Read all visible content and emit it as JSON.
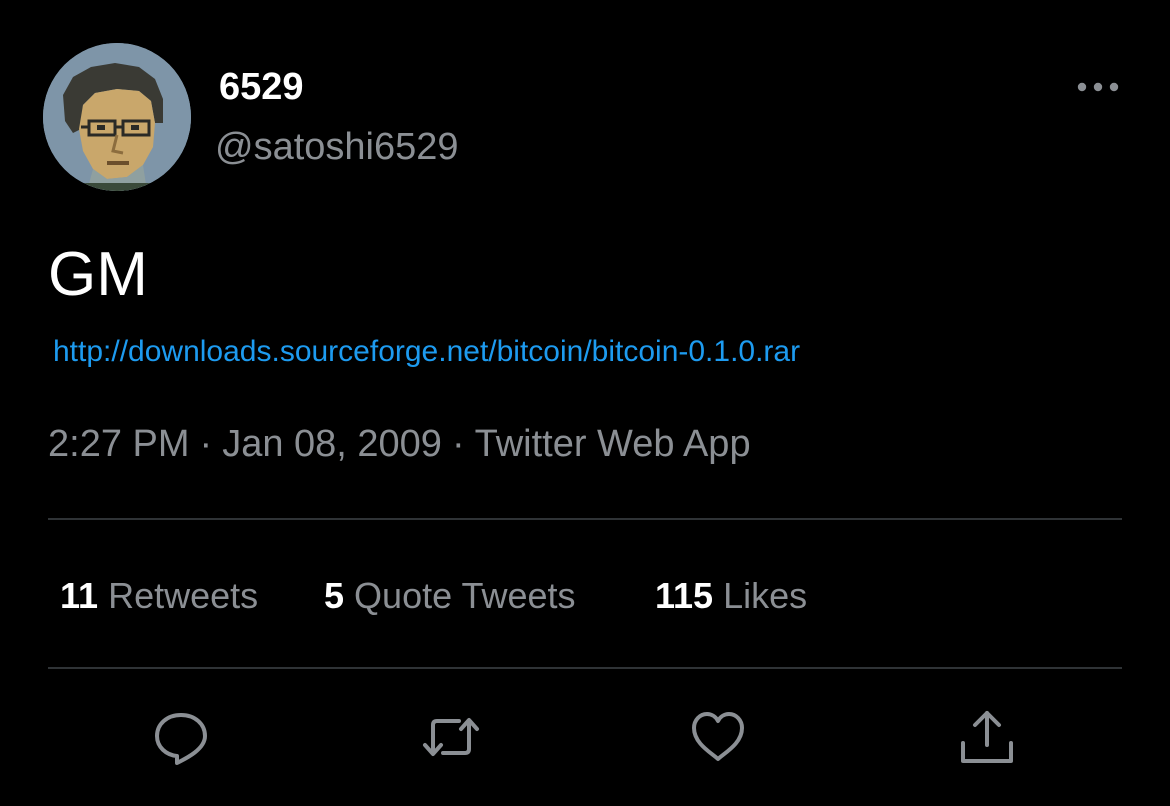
{
  "author": {
    "display_name": "6529",
    "handle": "@satoshi6529",
    "avatar": "pixel-art-portrait"
  },
  "tweet": {
    "text": "GM",
    "link": "http://downloads.sourceforge.net/bitcoin/bitcoin-0.1.0.rar",
    "time": "2:27 PM",
    "date": "Jan 08, 2009",
    "separator": "·",
    "source": "Twitter Web App"
  },
  "stats": {
    "retweets_count": "11",
    "retweets_label": "Retweets",
    "quotes_count": "5",
    "quotes_label": "Quote Tweets",
    "likes_count": "115",
    "likes_label": "Likes"
  },
  "actions": {
    "reply": "reply-icon",
    "retweet": "retweet-icon",
    "like": "heart-icon",
    "share": "share-icon"
  },
  "colors": {
    "background": "#000000",
    "primary_text": "#ffffff",
    "secondary_text": "#8b8f94",
    "link": "#1d9bf0",
    "divider": "#2f3336"
  }
}
